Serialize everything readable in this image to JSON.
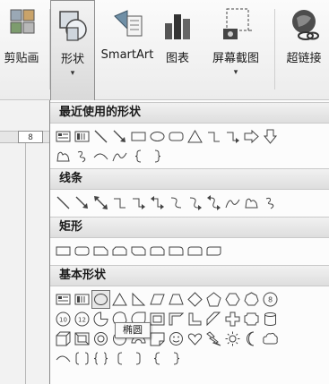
{
  "ribbon": {
    "buttons": [
      {
        "label": "剪贴画",
        "icon": "clipart-icon",
        "dropdown": false
      },
      {
        "label": "形状",
        "icon": "shapes-icon",
        "dropdown": true,
        "active": true
      },
      {
        "label": "SmartArt",
        "icon": "smartart-icon",
        "dropdown": false
      },
      {
        "label": "图表",
        "icon": "chart-icon",
        "dropdown": false
      },
      {
        "label": "屏幕截图",
        "icon": "screenshot-icon",
        "dropdown": true
      },
      {
        "label": "超链接",
        "icon": "hyperlink-icon",
        "dropdown": false
      }
    ],
    "dropdown_arrow": "▾"
  },
  "ruler": {
    "number": "8"
  },
  "gallery": {
    "sections": [
      {
        "title": "最近使用的形状"
      },
      {
        "title": "线条"
      },
      {
        "title": "矩形"
      },
      {
        "title": "基本形状"
      }
    ]
  },
  "tooltip": {
    "text": "椭圆"
  }
}
